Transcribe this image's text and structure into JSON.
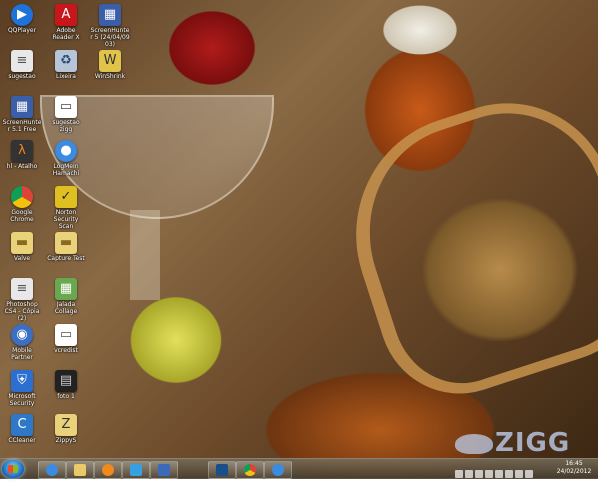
{
  "desktop_icons": [
    {
      "label": "QQPlayer",
      "icon": "qqplayer-icon",
      "color": "#1e73d8"
    },
    {
      "label": "Adobe Reader X",
      "icon": "adobe-reader-icon",
      "color": "#c8171b"
    },
    {
      "label": "ScreenHunter 5 (24/04/09 03)",
      "icon": "screenhunter-icon",
      "color": "#3a5ea8"
    },
    {
      "label": "sugestao",
      "icon": "document-icon",
      "color": "#e8e8e8"
    },
    {
      "label": "Lixeira",
      "icon": "recycle-bin-icon",
      "color": "#b6c6d8"
    },
    {
      "label": "WinShrink",
      "icon": "winshrink-icon",
      "color": "#dfc34a"
    },
    {
      "label": "ScreenHunter 5.1 Free",
      "icon": "screenhunter-free-icon",
      "color": "#3a5ea8"
    },
    {
      "label": "sugestao zigg",
      "icon": "image-icon",
      "color": "#ffffff"
    },
    {
      "label": "hl - Atalho",
      "icon": "half-life-icon",
      "color": "#333333"
    },
    {
      "label": "LogMeIn Hamachi",
      "icon": "hamachi-icon",
      "color": "#3b8be0"
    },
    {
      "label": "Google Chrome",
      "icon": "chrome-icon",
      "color": "#e0b020"
    },
    {
      "label": "Norton Security Scan",
      "icon": "norton-icon",
      "color": "#e0c020"
    },
    {
      "label": "Valve",
      "icon": "folder-icon",
      "color": "#e9d27a"
    },
    {
      "label": "Capture Test",
      "icon": "folder-icon",
      "color": "#e9d27a"
    },
    {
      "label": "Photoshop CS4 - Cópia (2)",
      "icon": "document-icon",
      "color": "#e8e8e8"
    },
    {
      "label": "Jalada Collage",
      "icon": "collage-icon",
      "color": "#6aa84f"
    },
    {
      "label": "Mobile Partner",
      "icon": "mobile-partner-icon",
      "color": "#3b6fc4"
    },
    {
      "label": "vcredist",
      "icon": "installer-icon",
      "color": "#ffffff"
    },
    {
      "label": "Microsoft Security",
      "icon": "microsoft-security-icon",
      "color": "#2d6fd0"
    },
    {
      "label": "foto 1",
      "icon": "photo-icon",
      "color": "#222222"
    },
    {
      "label": "CCleaner",
      "icon": "ccleaner-icon",
      "color": "#2f78c8"
    },
    {
      "label": "ZippyS",
      "icon": "zip-icon",
      "color": "#e9d27a"
    }
  ],
  "taskbar": {
    "start_label": "Start",
    "pinned": [
      {
        "name": "ie",
        "icon": "internet-explorer-icon",
        "color": "#3d8be0"
      },
      {
        "name": "explorer",
        "icon": "windows-explorer-icon",
        "color": "#e9c96a"
      },
      {
        "name": "media",
        "icon": "media-player-icon",
        "color": "#f08a1c"
      },
      {
        "name": "skype",
        "icon": "chat-icon",
        "color": "#38a0e0"
      },
      {
        "name": "word",
        "icon": "document-app-icon",
        "color": "#3a6ab8"
      },
      {
        "name": "photoshop",
        "icon": "photoshop-icon",
        "color": "#1b4f8a"
      },
      {
        "name": "chrome",
        "icon": "chrome-icon",
        "color": "#e0b020"
      },
      {
        "name": "hamachi",
        "icon": "hamachi-icon",
        "color": "#3b8be0"
      }
    ],
    "clock_time": "16:45",
    "clock_date": "24/02/2012"
  },
  "watermark": "ZIGG"
}
